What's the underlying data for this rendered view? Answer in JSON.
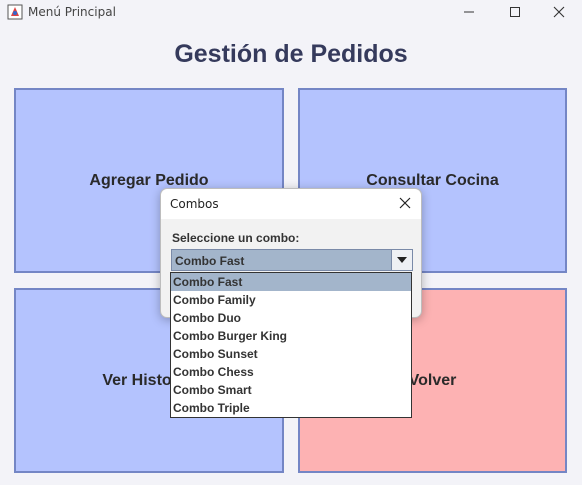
{
  "window": {
    "title": "Menú Principal",
    "icon": "java-app-icon",
    "controls": [
      "minimize-icon",
      "maximize-icon",
      "close-icon"
    ]
  },
  "page": {
    "title": "Gestión de Pedidos"
  },
  "tiles": {
    "agregar": "Agregar Pedido",
    "consultar": "Consultar Cocina",
    "historial": "Ver Historial",
    "volver": "Volver"
  },
  "colors": {
    "tile_blue": "#b4c3fe",
    "tile_red": "#fdb2b3",
    "tile_border": "#7486c5",
    "selection": "#a3b5cb",
    "title_text": "#353a5c"
  },
  "dialog": {
    "title": "Combos",
    "label": "Seleccione un combo:",
    "selected": "Combo Fast",
    "options": [
      "Combo Fast",
      "Combo Family",
      "Combo Duo",
      "Combo Burger King",
      "Combo Sunset",
      "Combo Chess",
      "Combo Smart",
      "Combo Triple"
    ]
  }
}
